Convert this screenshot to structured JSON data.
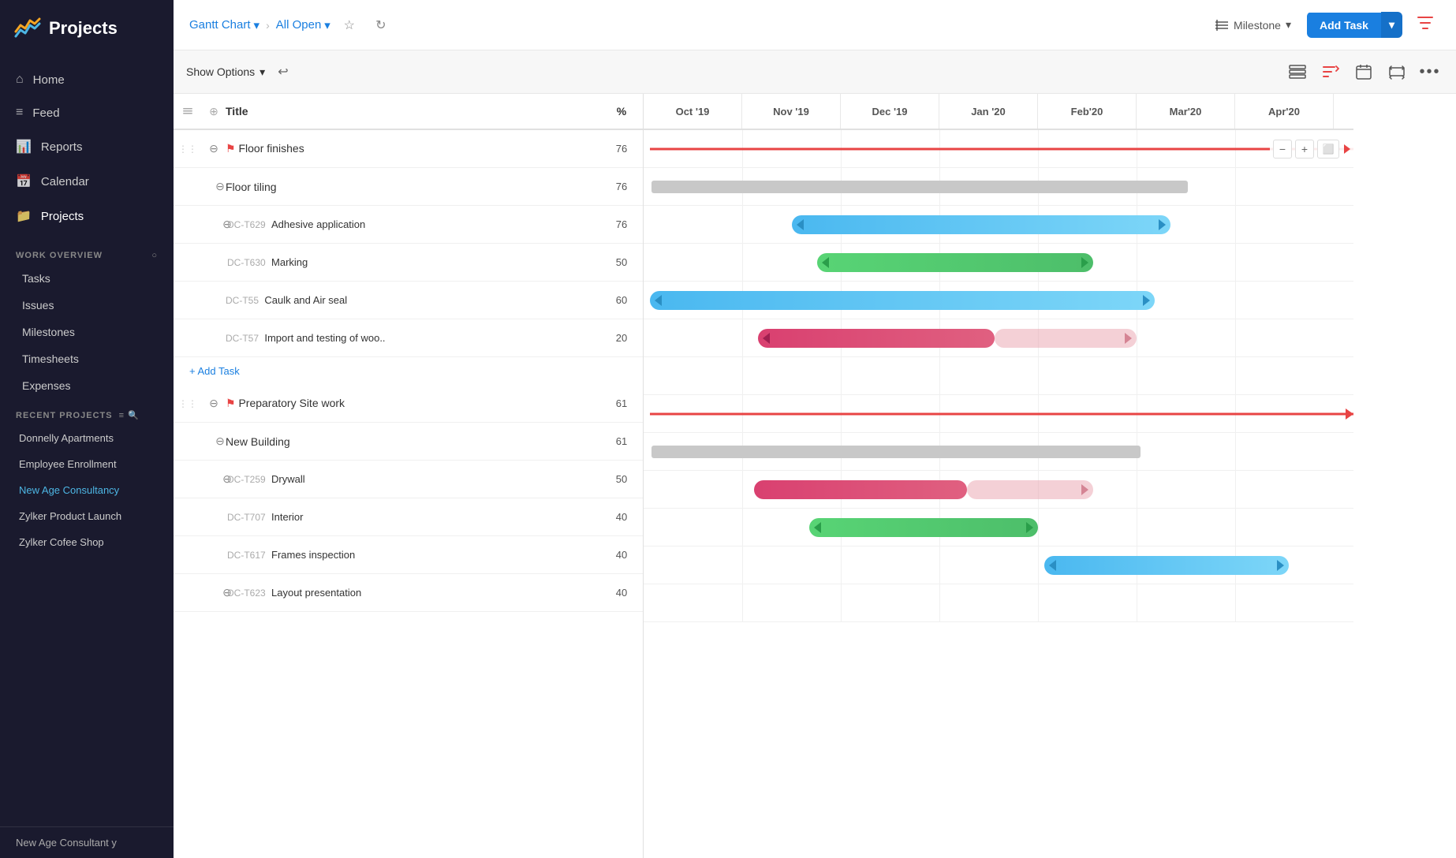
{
  "sidebar": {
    "logo_text": "Projects",
    "nav_items": [
      {
        "id": "home",
        "label": "Home",
        "icon": "⌂"
      },
      {
        "id": "feed",
        "label": "Feed",
        "icon": "≡"
      },
      {
        "id": "reports",
        "label": "Reports",
        "icon": "📊"
      },
      {
        "id": "calendar",
        "label": "Calendar",
        "icon": "📅"
      },
      {
        "id": "projects",
        "label": "Projects",
        "icon": "📁"
      }
    ],
    "work_overview_label": "WORK OVERVIEW",
    "work_overview_items": [
      {
        "id": "tasks",
        "label": "Tasks"
      },
      {
        "id": "issues",
        "label": "Issues"
      },
      {
        "id": "milestones",
        "label": "Milestones"
      },
      {
        "id": "timesheets",
        "label": "Timesheets"
      },
      {
        "id": "expenses",
        "label": "Expenses"
      }
    ],
    "recent_projects_label": "RECENT PROJECTS",
    "recent_projects": [
      {
        "id": "donnelly",
        "label": "Donnelly Apartments"
      },
      {
        "id": "employee",
        "label": "Employee Enrollment"
      },
      {
        "id": "newage",
        "label": "New Age Consultancy"
      },
      {
        "id": "zylker_launch",
        "label": "Zylker Product Launch"
      },
      {
        "id": "zylker_coffee",
        "label": "Zylker Cofee Shop"
      }
    ],
    "bottom_text": "New Age Consultant y"
  },
  "topbar": {
    "gantt_chart_label": "Gantt Chart",
    "all_open_label": "All Open",
    "milestone_label": "Milestone",
    "add_task_label": "Add Task",
    "filter_icon": "▼"
  },
  "toolbar": {
    "show_options_label": "Show Options",
    "undo_label": "↩"
  },
  "gantt": {
    "columns": {
      "title": "Title",
      "percent": "%"
    },
    "months": [
      "Oct '19",
      "Nov '19",
      "Dec '19",
      "Jan '20",
      "Feb'20",
      "Mar'20",
      "Apr'20"
    ],
    "rows": [
      {
        "id": "g1",
        "type": "group",
        "indent": 0,
        "title": "Floor finishes",
        "pct": "76",
        "bar": "red-line"
      },
      {
        "id": "g1a",
        "type": "group",
        "indent": 1,
        "title": "Floor tiling",
        "pct": "76",
        "bar": "gray"
      },
      {
        "id": "t629",
        "type": "task",
        "indent": 2,
        "task_id": "DC-T629",
        "title": "Adhesive application",
        "pct": "76",
        "bar": "blue"
      },
      {
        "id": "t630",
        "type": "task",
        "indent": 2,
        "task_id": "DC-T630",
        "title": "Marking",
        "pct": "50",
        "bar": "green"
      },
      {
        "id": "t55",
        "type": "task",
        "indent": 1,
        "task_id": "DC-T55",
        "title": "Caulk and Air seal",
        "pct": "60",
        "bar": "blue"
      },
      {
        "id": "t57",
        "type": "task",
        "indent": 1,
        "task_id": "DC-T57",
        "title": "Import and testing of woo..",
        "pct": "20",
        "bar": "pink"
      },
      {
        "id": "add1",
        "type": "add",
        "label": "Add Task"
      },
      {
        "id": "g2",
        "type": "group",
        "indent": 0,
        "title": "Preparatory Site work",
        "pct": "61",
        "bar": "red-line"
      },
      {
        "id": "g2a",
        "type": "group",
        "indent": 1,
        "title": "New Building",
        "pct": "61",
        "bar": "gray"
      },
      {
        "id": "t259",
        "type": "task",
        "indent": 2,
        "task_id": "DC-T259",
        "title": "Drywall",
        "pct": "50",
        "bar": "pink"
      },
      {
        "id": "t707",
        "type": "task",
        "indent": 2,
        "task_id": "DC-T707",
        "title": "Interior",
        "pct": "40",
        "bar": "green"
      },
      {
        "id": "t617",
        "type": "task",
        "indent": 2,
        "task_id": "DC-T617",
        "title": "Frames inspection",
        "pct": "40",
        "bar": "blue"
      },
      {
        "id": "t623",
        "type": "task",
        "indent": 2,
        "task_id": "DC-T623",
        "title": "Layout presentation",
        "pct": "40",
        "bar": "blue"
      }
    ]
  }
}
